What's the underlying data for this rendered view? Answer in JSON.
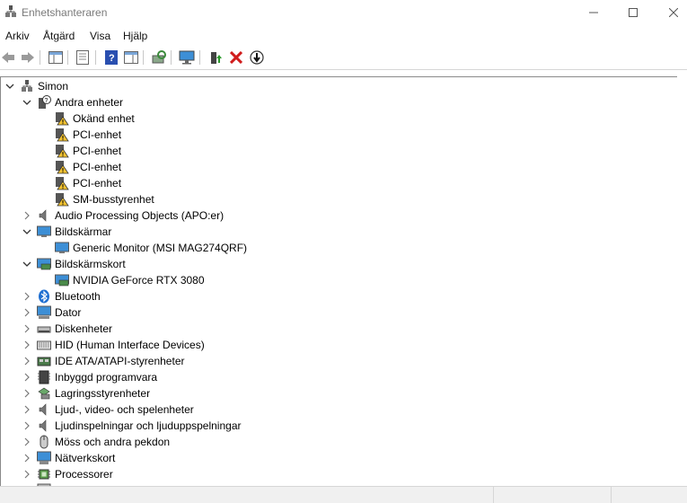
{
  "window": {
    "title": "Enhetshanteraren"
  },
  "menu": [
    "Arkiv",
    "Åtgärd",
    "Visa",
    "Hjälp"
  ],
  "toolbar": [
    "back-arrow-icon",
    "forward-arrow-icon",
    "show-hide-console-tree-icon",
    "properties-icon",
    "help-icon",
    "action-pane-icon",
    "scan-hardware-icon",
    "monitor-icon",
    "update-driver-icon",
    "uninstall-device-icon",
    "disable-device-icon"
  ],
  "tree": {
    "root": "Simon",
    "items": [
      {
        "label": "Andra enheter",
        "icon": "unknown-device-icon",
        "expanded": true
      },
      {
        "label": "Okänd enhet",
        "icon": "warning-device-icon",
        "child": true
      },
      {
        "label": "PCI-enhet",
        "icon": "warning-device-icon",
        "child": true
      },
      {
        "label": "PCI-enhet",
        "icon": "warning-device-icon",
        "child": true
      },
      {
        "label": "PCI-enhet",
        "icon": "warning-device-icon",
        "child": true
      },
      {
        "label": "PCI-enhet",
        "icon": "warning-device-icon",
        "child": true
      },
      {
        "label": "SM-busstyrenhet",
        "icon": "warning-device-icon",
        "child": true
      },
      {
        "label": "Audio Processing Objects (APO:er)",
        "icon": "speaker-icon",
        "expanded": false
      },
      {
        "label": "Bildskärmar",
        "icon": "monitor-icon",
        "expanded": true
      },
      {
        "label": "Generic Monitor (MSI MAG274QRF)",
        "icon": "monitor-icon",
        "child": true
      },
      {
        "label": "Bildskärmskort",
        "icon": "display-adapter-icon",
        "expanded": true
      },
      {
        "label": "NVIDIA GeForce RTX 3080",
        "icon": "display-adapter-icon",
        "child": true
      },
      {
        "label": "Bluetooth",
        "icon": "bluetooth-icon",
        "expanded": false
      },
      {
        "label": "Dator",
        "icon": "computer-icon",
        "expanded": false
      },
      {
        "label": "Diskenheter",
        "icon": "disk-drive-icon",
        "expanded": false
      },
      {
        "label": "HID (Human Interface Devices)",
        "icon": "hid-icon",
        "expanded": false
      },
      {
        "label": "IDE ATA/ATAPI-styrenheter",
        "icon": "ide-controller-icon",
        "expanded": false
      },
      {
        "label": "Inbyggd programvara",
        "icon": "firmware-icon",
        "expanded": false
      },
      {
        "label": "Lagringsstyrenheter",
        "icon": "storage-controller-icon",
        "expanded": false
      },
      {
        "label": "Ljud-, video- och spelenheter",
        "icon": "speaker-icon",
        "expanded": false
      },
      {
        "label": "Ljudinspelningar och ljuduppspelningar",
        "icon": "speaker-icon",
        "expanded": false
      },
      {
        "label": "Möss och andra pekdon",
        "icon": "mouse-icon",
        "expanded": false
      },
      {
        "label": "Nätverkskort",
        "icon": "network-adapter-icon",
        "expanded": false
      },
      {
        "label": "Processorer",
        "icon": "processor-icon",
        "expanded": false
      }
    ]
  }
}
